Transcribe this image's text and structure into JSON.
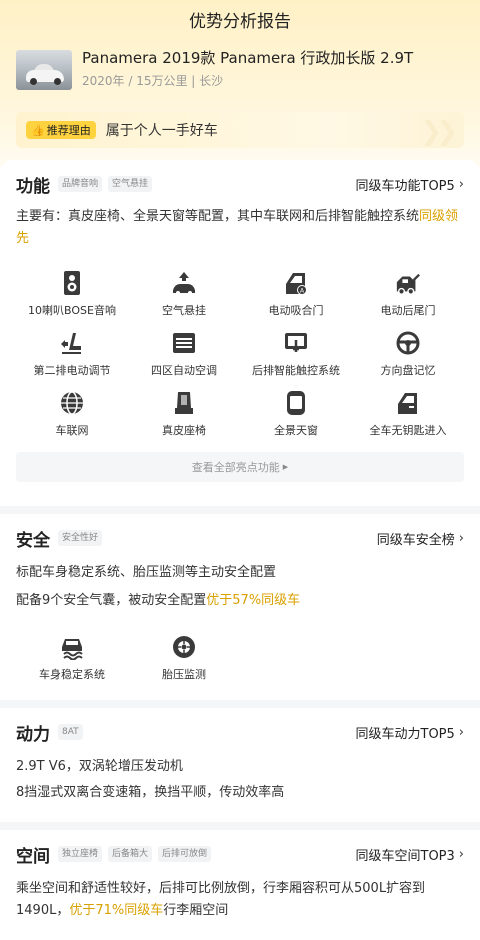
{
  "page": {
    "title": "优势分析报告"
  },
  "car": {
    "name": "Panamera 2019款 Panamera 行政加长版 2.9T",
    "meta": "2020年 / 15万公里 | 长沙"
  },
  "reason": {
    "tag": "推荐理由",
    "text": "属于个人一手好车"
  },
  "function": {
    "title": "功能",
    "chips": [
      "品牌音响",
      "空气悬挂"
    ],
    "link": "同级车功能TOP5",
    "desc_prefix": "主要有：真皮座椅、全景天窗等配置，其中车联网和后排智能触控系统",
    "desc_highlight": "同级领先",
    "features": [
      {
        "label": "10喇叭BOSE音响",
        "icon": "speaker-icon"
      },
      {
        "label": "空气悬挂",
        "icon": "air-suspension-icon"
      },
      {
        "label": "电动吸合门",
        "icon": "soft-close-door-icon"
      },
      {
        "label": "电动后尾门",
        "icon": "power-tailgate-icon"
      },
      {
        "label": "第二排电动调节",
        "icon": "power-seat-icon"
      },
      {
        "label": "四区自动空调",
        "icon": "climate-control-icon"
      },
      {
        "label": "后排智能触控系统",
        "icon": "touch-screen-icon"
      },
      {
        "label": "方向盘记忆",
        "icon": "steering-wheel-icon"
      },
      {
        "label": "车联网",
        "icon": "connected-car-icon"
      },
      {
        "label": "真皮座椅",
        "icon": "leather-seat-icon"
      },
      {
        "label": "全景天窗",
        "icon": "panoramic-sunroof-icon"
      },
      {
        "label": "全车无钥匙进入",
        "icon": "keyless-entry-icon"
      }
    ],
    "view_all": "查看全部亮点功能"
  },
  "safety": {
    "title": "安全",
    "chips": [
      "安全性好"
    ],
    "link": "同级车安全榜",
    "line1": "标配车身稳定系统、胎压监测等主动安全配置",
    "line2_prefix": "配备9个安全气囊，被动安全配置",
    "line2_highlight": "优于57%同级车",
    "features": [
      {
        "label": "车身稳定系统",
        "icon": "stability-control-icon"
      },
      {
        "label": "胎压监测",
        "icon": "tire-pressure-icon"
      }
    ]
  },
  "power": {
    "title": "动力",
    "chips": [
      "8AT"
    ],
    "link": "同级车动力TOP5",
    "line1": "2.9T V6，双涡轮增压发动机",
    "line2": "8挡湿式双离合变速箱，换挡平顺，传动效率高"
  },
  "space": {
    "title": "空间",
    "chips": [
      "独立座椅",
      "后备箱大",
      "后排可放倒"
    ],
    "link": "同级车空间TOP3",
    "desc_prefix": "乘坐空间和舒适性较好，后排可比例放倒，行李厢容积可从500L扩容到1490L，",
    "desc_highlight": "优于71%同级车",
    "desc_suffix": "行李厢空间"
  },
  "colors": {
    "accent": "#ffd23f",
    "highlight": "#d9a100",
    "icon": "#3a3a3a"
  }
}
